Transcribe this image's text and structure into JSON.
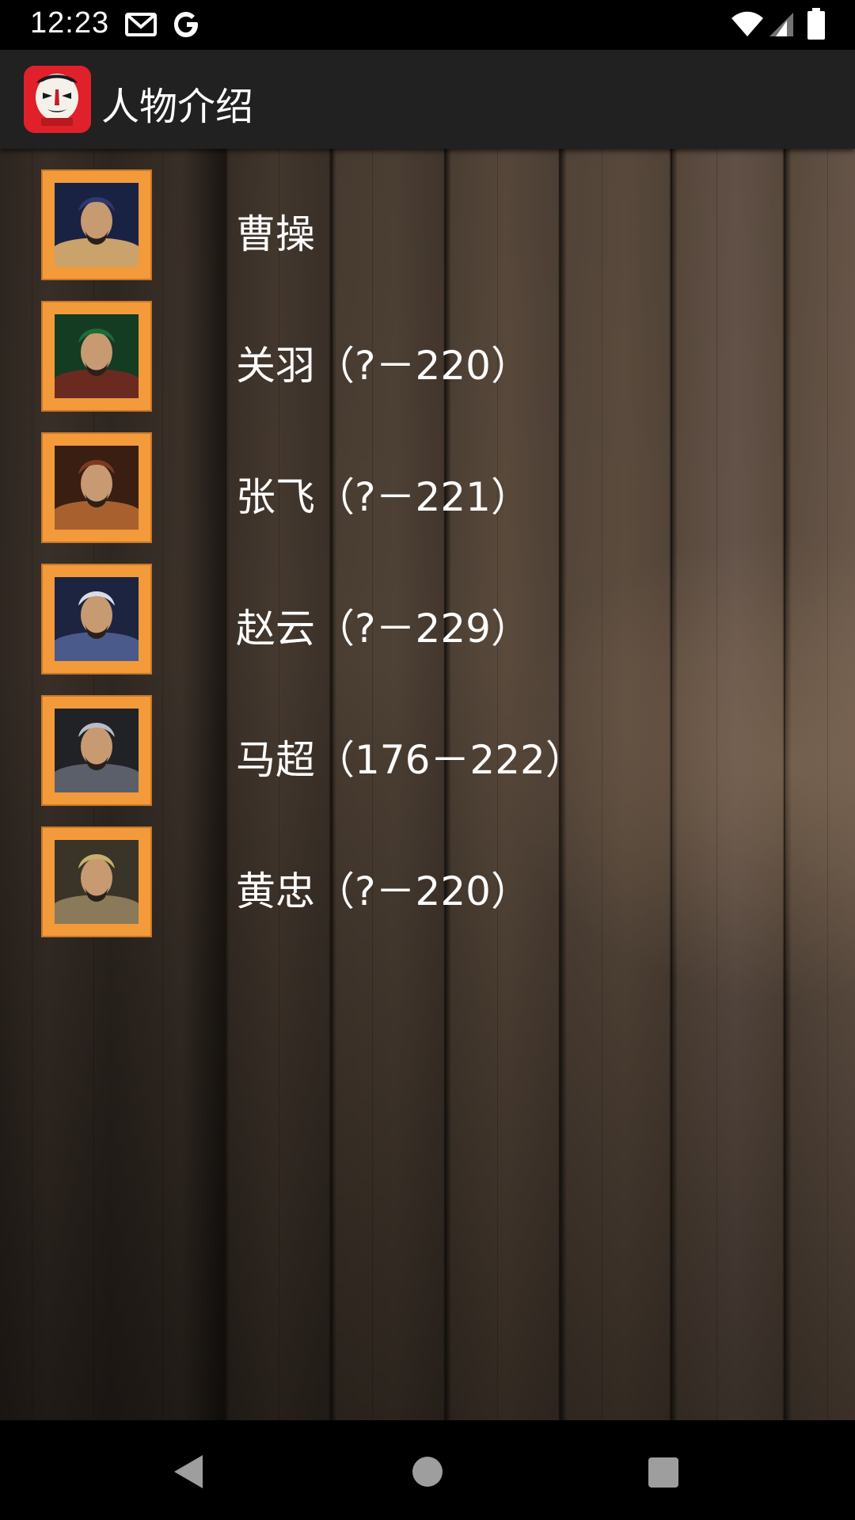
{
  "status_bar": {
    "time": "12:23",
    "icons": [
      "gmail-icon",
      "google-icon",
      "wifi-icon",
      "cell-signal-icon",
      "battery-icon"
    ]
  },
  "app_bar": {
    "title": "人物介绍",
    "logo_icon": "opera-mask-logo-icon"
  },
  "characters": [
    {
      "name": "曹操",
      "portrait_colors": [
        "#2e3a6e",
        "#c9a36b",
        "#1a2244"
      ]
    },
    {
      "name": "关羽（?－220）",
      "portrait_colors": [
        "#1e6a3a",
        "#6b2a20",
        "#143c22"
      ]
    },
    {
      "name": "张飞（?－221）",
      "portrait_colors": [
        "#7a3a22",
        "#a8612e",
        "#3a1e12"
      ]
    },
    {
      "name": "赵云（?－229）",
      "portrait_colors": [
        "#d8dde6",
        "#4a5a8a",
        "#1c2440"
      ]
    },
    {
      "name": "马超（176－222）",
      "portrait_colors": [
        "#b9bcc4",
        "#5a5f6a",
        "#202226"
      ]
    },
    {
      "name": "黄忠（?－220）",
      "portrait_colors": [
        "#c9b06a",
        "#8a7a5a",
        "#3a3428"
      ]
    }
  ],
  "colors": {
    "frame": "#f39a3b",
    "app_bar": "#212121",
    "logo": "#e0202a"
  },
  "nav_bar": {
    "back_icon": "back-triangle-icon",
    "home_icon": "home-circle-icon",
    "recents_icon": "recents-square-icon"
  }
}
